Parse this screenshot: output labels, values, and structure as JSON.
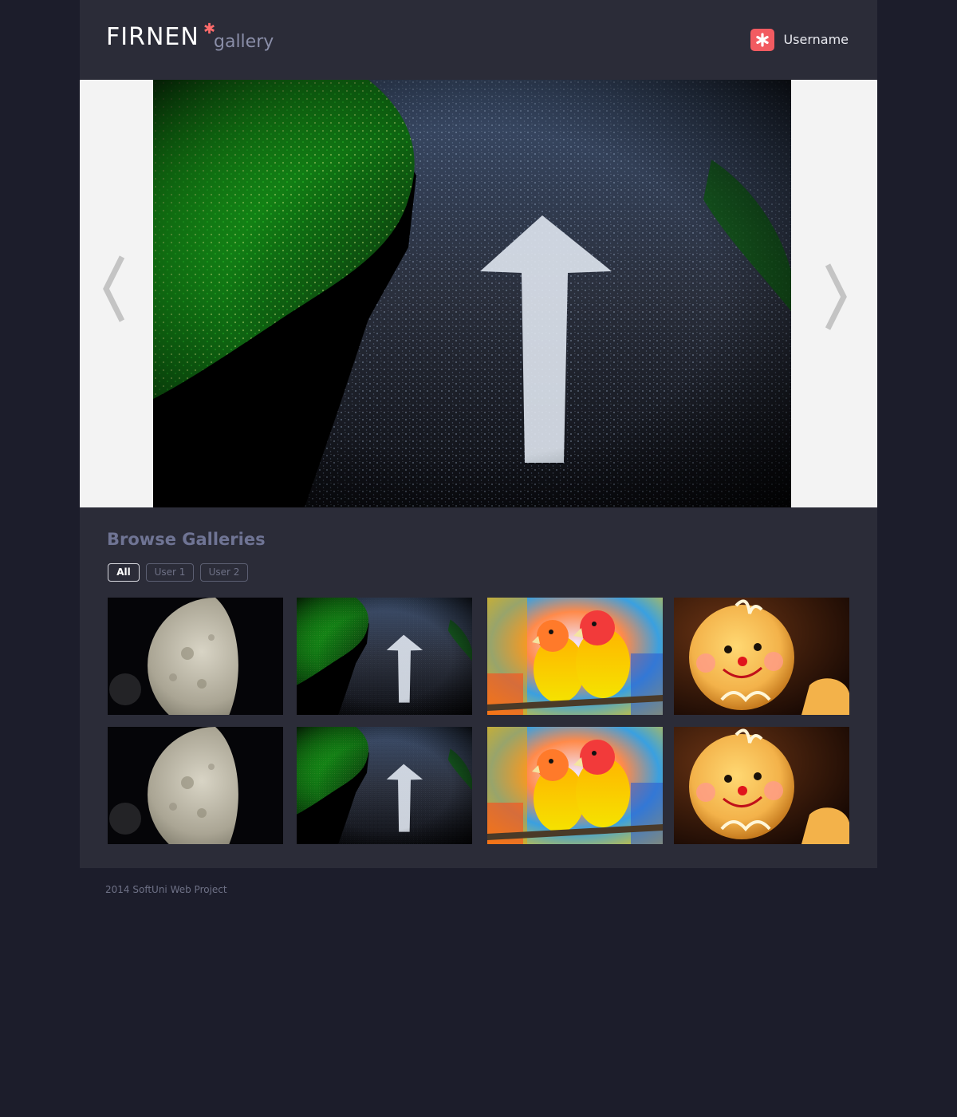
{
  "header": {
    "logo_main": "FIRNEN",
    "logo_sub": "gallery",
    "user_icon": "asterisk-icon",
    "username": "Username"
  },
  "slider": {
    "image": "road-arrow-photo",
    "prev_icon": "chevron-left-icon",
    "next_icon": "chevron-right-icon"
  },
  "browse": {
    "title": "Browse Galleries",
    "filters": [
      "All",
      "User 1",
      "User 2"
    ],
    "active_filter": "All",
    "thumbnails": [
      "moon-photo",
      "road-arrow-photo",
      "parrots-photo",
      "gingerbread-photo",
      "moon-photo",
      "road-arrow-photo",
      "parrots-photo",
      "gingerbread-photo"
    ]
  },
  "footer": {
    "text": "2014 SoftUni Web Project"
  },
  "colors": {
    "page_bg": "#1c1d2b",
    "panel_bg": "#2b2c38",
    "accent": "#f25b61",
    "slider_bg": "#f3f3f3"
  }
}
